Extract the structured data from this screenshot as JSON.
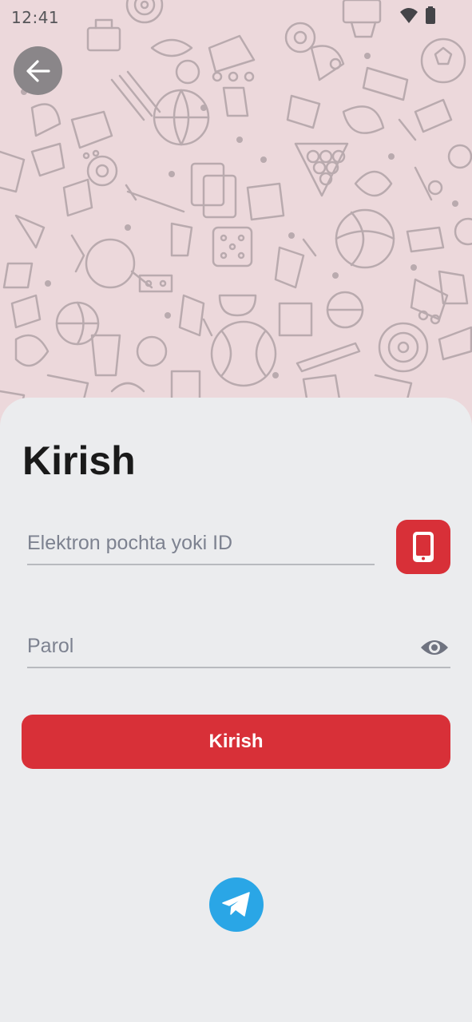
{
  "status_bar": {
    "time": "12:41",
    "icons": [
      "wifi-icon",
      "battery-icon"
    ]
  },
  "header": {
    "back_icon": "arrow-left-icon",
    "background_icons": [
      "sports-pattern"
    ]
  },
  "login": {
    "title": "Kirish",
    "email_placeholder": "Elektron pochta yoki ID",
    "email_value": "",
    "phone_login_icon": "smartphone-icon",
    "password_placeholder": "Parol",
    "password_value": "",
    "password_toggle_icon": "eye-icon",
    "submit_label": "Kirish",
    "telegram_icon": "telegram-icon"
  },
  "colors": {
    "accent": "#d83038",
    "telegram": "#2aa6e6",
    "hero_background": "#ecd8db",
    "sheet_background": "#ebecee"
  }
}
